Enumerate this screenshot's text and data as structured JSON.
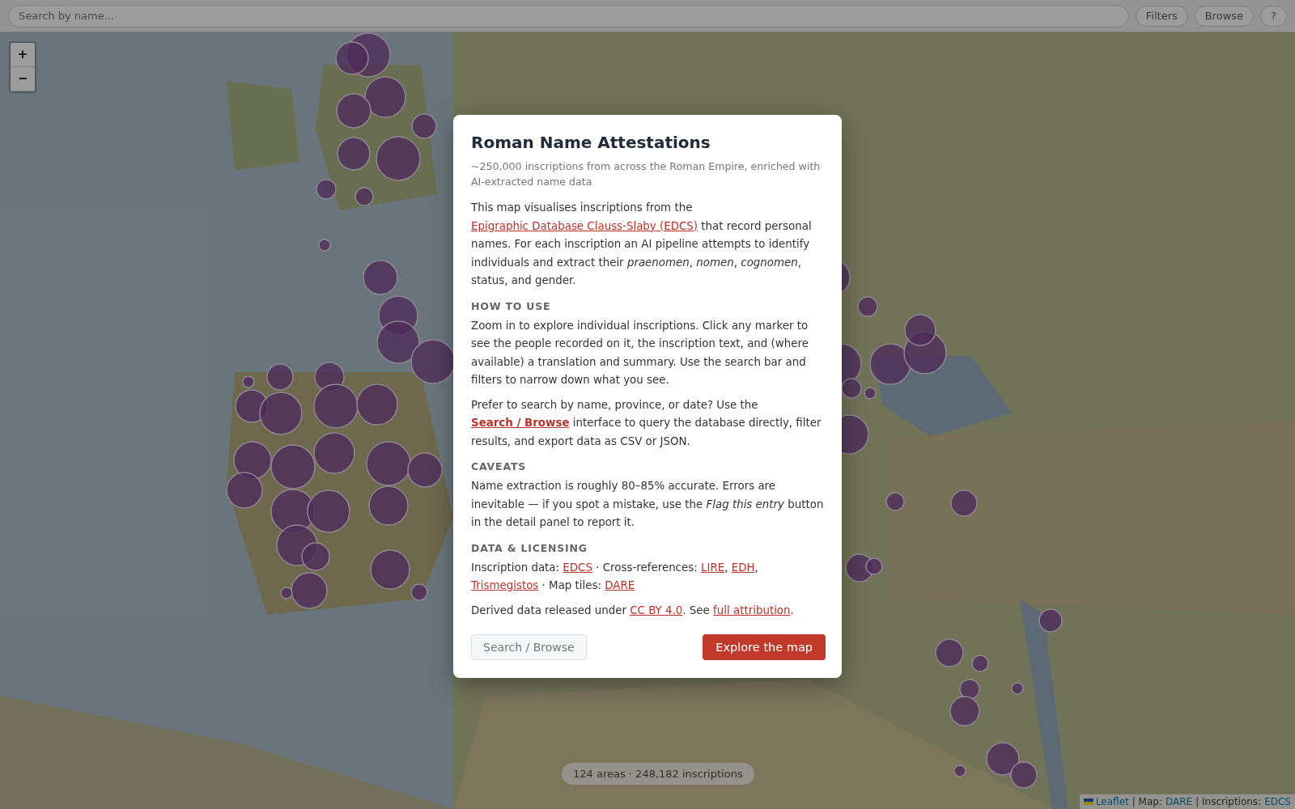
{
  "top_bar": {
    "search": {
      "placeholder": "Search by name..."
    },
    "buttons": [
      "Filters",
      "Browse",
      "?"
    ]
  },
  "map": {
    "zoom_controls": [
      "+",
      "−"
    ],
    "status": "124 areas · 248,182 inscriptions",
    "attribution": [
      {
        "kind": "link",
        "text": "Leaflet",
        "flag": true
      },
      {
        "kind": "text",
        "text": "| Map:"
      },
      {
        "kind": "link",
        "text": "DARE"
      },
      {
        "kind": "text",
        "text": "| Inscriptions:"
      },
      {
        "kind": "link",
        "text": "EDCS"
      }
    ]
  },
  "dialog": {
    "title": "Roman Name Attestations",
    "subtitle": "~250,000 inscriptions from across the Roman Empire, enriched with AI-extracted name data",
    "sections": [
      {
        "paragraphs": [
          [
            {
              "kind": "text",
              "text": "This map visualises inscriptions from the "
            },
            {
              "kind": "link",
              "text": "Epigraphic Database Clauss-Slaby (EDCS)"
            },
            {
              "kind": "text",
              "text": " that record personal names. For each inscription an AI pipeline attempts to identify individuals and extract their *praenomen*, *nomen*, *cognomen*, status, and gender."
            }
          ]
        ]
      },
      {
        "heading": "HOW TO USE",
        "paragraphs": [
          [
            {
              "kind": "text",
              "text": "Zoom in to explore individual inscriptions. Click any marker to see the people recorded on it, the inscription text, and (where available) a translation and summary. Use the search bar and filters to narrow down what you see."
            }
          ],
          [
            {
              "kind": "text",
              "text": "Prefer to search by name, province, or date? Use the "
            },
            {
              "kind": "link",
              "text": "Search / Browse",
              "bold": true
            },
            {
              "kind": "text",
              "text": " interface to query the database directly, filter results, and export data as CSV or JSON."
            }
          ]
        ]
      },
      {
        "heading": "CAVEATS",
        "paragraphs": [
          [
            {
              "kind": "text",
              "text": "Name extraction is roughly 80–85% accurate. Errors are inevitable — if you spot a mistake, use the *Flag this entry* button in the detail panel to report it."
            }
          ]
        ]
      },
      {
        "heading": "DATA & LICENSING",
        "paragraphs": [
          [
            {
              "kind": "text",
              "text": "Inscription data: "
            },
            {
              "kind": "link",
              "text": "EDCS"
            },
            {
              "kind": "text",
              "text": " · Cross-references: "
            },
            {
              "kind": "link",
              "text": "LIRE"
            },
            {
              "kind": "text",
              "text": ", "
            },
            {
              "kind": "link",
              "text": "EDH"
            },
            {
              "kind": "text",
              "text": ", "
            },
            {
              "kind": "link",
              "text": "Trismegistos"
            },
            {
              "kind": "text",
              "text": " · Map tiles: "
            },
            {
              "kind": "link",
              "text": "DARE"
            }
          ],
          [
            {
              "kind": "text",
              "text": "Derived data released under "
            },
            {
              "kind": "link",
              "text": "CC BY 4.0"
            },
            {
              "kind": "text",
              "text": ". See "
            },
            {
              "kind": "link",
              "text": "full attribution"
            },
            {
              "kind": "text",
              "text": "."
            }
          ]
        ]
      }
    ],
    "secondary_button": "Search / Browse",
    "primary_button": "Explore the map"
  }
}
